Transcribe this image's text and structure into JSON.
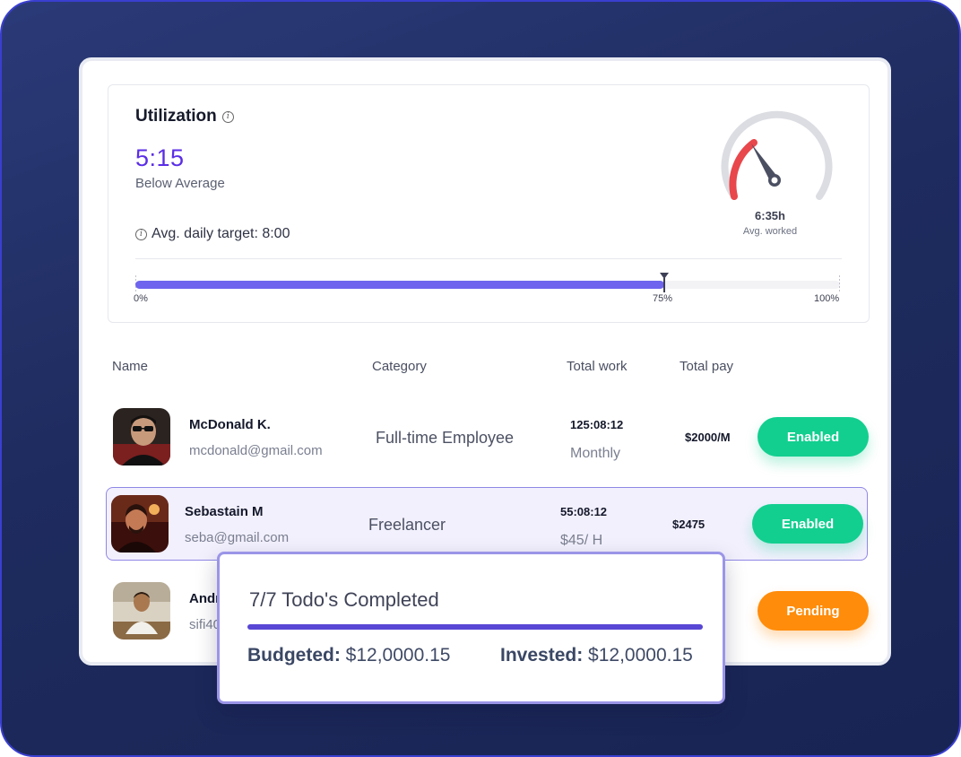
{
  "utilization": {
    "title": "Utilization",
    "value": "5:15",
    "status": "Below Average",
    "avg_target": "Avg. daily target: 8:00",
    "info_icon": "info-icon",
    "gauge": {
      "value": "6:35h",
      "label": "Avg. worked",
      "accent_color": "#e8474c",
      "track_color": "#dcdde2"
    },
    "progress": {
      "fraction": 0.75,
      "labels": [
        "0%",
        "75%",
        "100%"
      ],
      "fill_color": "#6e64ee"
    }
  },
  "table": {
    "headers": {
      "name": "Name",
      "category": "Category",
      "total_work": "Total work",
      "total_pay": "Total pay"
    },
    "rows": [
      {
        "name": "McDonald K.",
        "email": "mcdonald@gmail.com",
        "category": "Full-time Employee",
        "total_work": "125:08:12",
        "work_period": "Monthly",
        "pay": "$2000/M",
        "status": "Enabled"
      },
      {
        "name": "Sebastain M",
        "email": "seba@gmail.com",
        "category": "Freelancer",
        "total_work": "55:08:12",
        "work_period": "$45/ H",
        "pay": "$2475",
        "status": "Enabled"
      },
      {
        "name": "Andr",
        "email": "sifi40",
        "category": "",
        "total_work": "",
        "work_period": "",
        "pay": "",
        "status": "Pending"
      }
    ]
  },
  "popup": {
    "title": "7/7 Todo's Completed",
    "budgeted_label": "Budgeted:",
    "budgeted_value": "$12,0000.15",
    "invested_label": "Invested:",
    "invested_value": "$12,0000.15"
  },
  "colors": {
    "accent": "#5b2ee6",
    "enabled": "#12cf8f",
    "pending": "#ff8c0a",
    "background": "#1e2b5e"
  }
}
